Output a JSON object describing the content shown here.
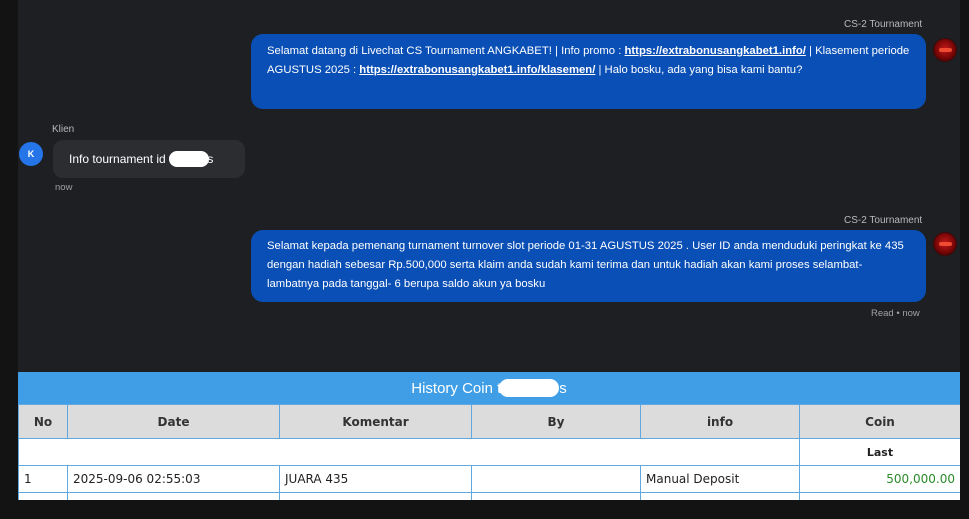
{
  "chat": {
    "msg1": {
      "sender": "CS-2 Tournament",
      "t1": "Selamat datang di Livechat CS Tournament ANGKABET! | Info promo : ",
      "link1": "https://extrabonusangkabet1.info/",
      "t2": " | Klasement periode AGUSTUS 2025 : ",
      "link2": "https://extrabonusangkabet1.info/klasemen/",
      "t3": " | Halo bosku, ada yang bisa kami bantu?"
    },
    "msg2": {
      "sender": "Klien",
      "avatar_letter": "K",
      "text_start": "Info tournament id t",
      "text_end": "s",
      "time": "now"
    },
    "msg3": {
      "sender": "CS-2 Tournament",
      "text": "Selamat kepada pemenang turnament turnover slot periode 01-31 AGUSTUS 2025 . User ID anda menduduki peringkat ke 435 dengan hadiah sebesar Rp.500,000 serta klaim anda sudah kami terima dan untuk hadiah akan kami proses selambat-lambatnya pada tanggal- 6 berupa saldo akun ya bosku",
      "status": "Read",
      "dot": "•",
      "time": "now"
    }
  },
  "history": {
    "title_start": "History Coin t",
    "title_end": "s",
    "columns": [
      "No",
      "Date",
      "Komentar",
      "By",
      "info",
      "Coin"
    ],
    "subheader": "Last",
    "rows": [
      {
        "no": "1",
        "date": "2025-09-06 02:55:03",
        "komentar": "JUARA 435",
        "by": "",
        "info": "Manual Deposit",
        "coin": "500,000.00"
      }
    ]
  }
}
